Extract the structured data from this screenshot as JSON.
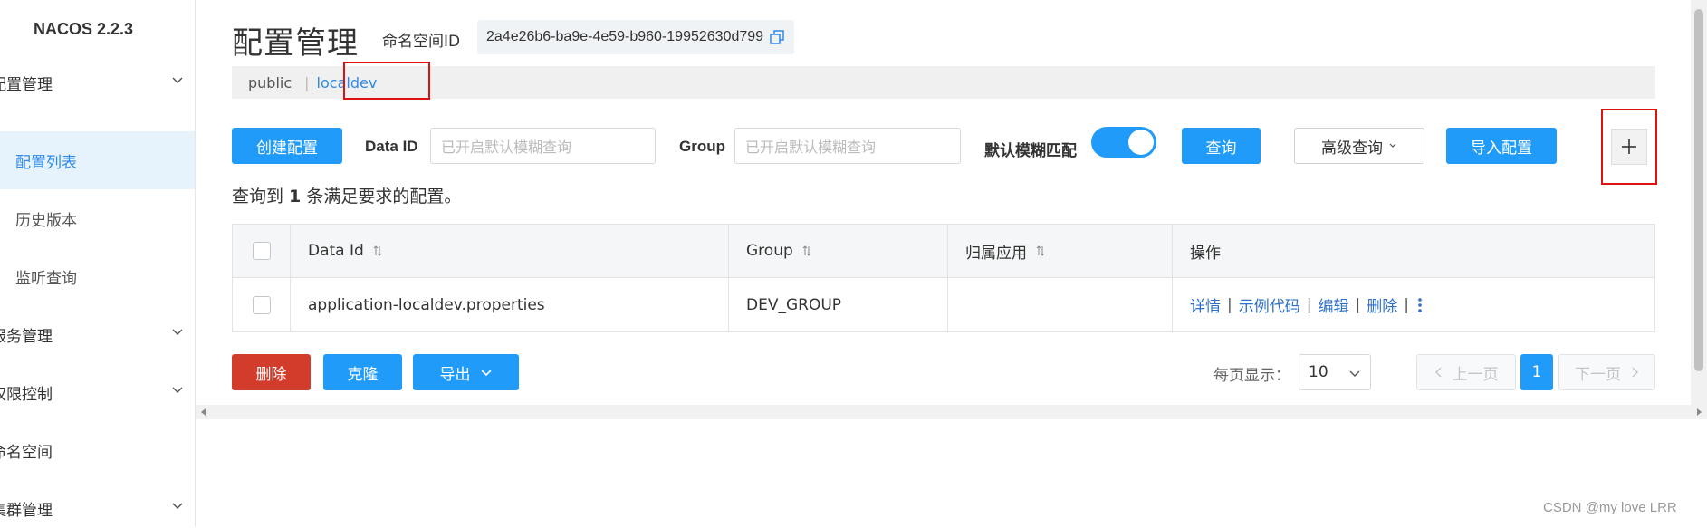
{
  "app": {
    "brand": "NACOS 2.2.3"
  },
  "sidebar": {
    "groups": [
      {
        "label": "配置管理",
        "items": [
          "配置列表",
          "历史版本",
          "监听查询"
        ]
      },
      {
        "label": "服务管理"
      },
      {
        "label": "权限控制"
      },
      {
        "label": "命名空间"
      },
      {
        "label": "集群管理"
      }
    ],
    "active_item": "配置列表"
  },
  "header": {
    "title": "配置管理",
    "namespace_label": "命名空间ID",
    "namespace_id": "2a4e26b6-ba9e-4e59-b960-19952630d799"
  },
  "namespaces": {
    "public": "public",
    "active": "localdev",
    "separator": "|"
  },
  "toolbar": {
    "create_label": "创建配置",
    "data_id_label": "Data ID",
    "data_id_placeholder": "已开启默认模糊查询",
    "group_label": "Group",
    "group_placeholder": "已开启默认模糊查询",
    "fuzzy_label": "默认模糊匹配",
    "fuzzy_enabled": true,
    "query_label": "查询",
    "advanced_label": "高级查询",
    "import_label": "导入配置",
    "plus_label": "+"
  },
  "result": {
    "prefix": "查询到 ",
    "count": "1",
    "suffix": " 条满足要求的配置。"
  },
  "table": {
    "columns": [
      "Data Id",
      "Group",
      "归属应用",
      "操作"
    ],
    "rows": [
      {
        "data_id": "application-localdev.properties",
        "group": "DEV_GROUP",
        "app": "",
        "actions": [
          "详情",
          "示例代码",
          "编辑",
          "删除"
        ]
      }
    ]
  },
  "bulk": {
    "delete_label": "删除",
    "clone_label": "克隆",
    "export_label": "导出"
  },
  "pagination": {
    "page_size_label": "每页显示：",
    "page_size": "10",
    "prev_label": "上一页",
    "current_page": "1",
    "next_label": "下一页"
  },
  "watermark": "CSDN @my love  LRR",
  "colors": {
    "primary": "#209bfa",
    "danger": "#d23c2a",
    "link": "#2e6fc7",
    "highlight_border": "#d11"
  }
}
